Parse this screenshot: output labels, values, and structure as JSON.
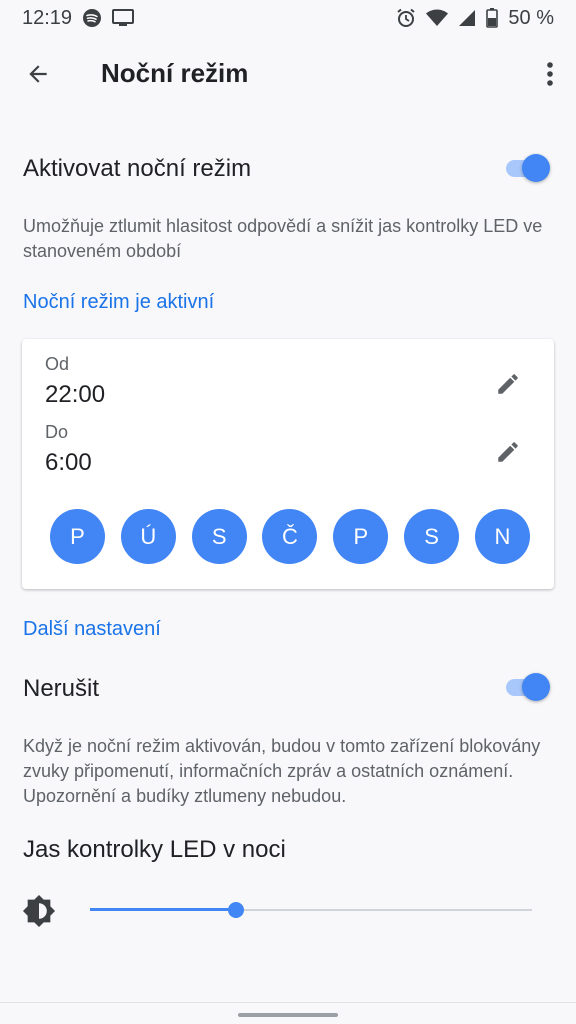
{
  "status_bar": {
    "time": "12:19",
    "battery": "50 %",
    "icons": [
      "spotify-icon",
      "cast-icon",
      "alarm-icon",
      "wifi-icon",
      "signal-icon",
      "battery-icon"
    ]
  },
  "header": {
    "title": "Noční režim",
    "back_icon": "arrow-back-icon",
    "menu_icon": "more-vert-icon"
  },
  "night_mode": {
    "toggle_label": "Aktivovat noční režim",
    "toggle_on": true,
    "description": "Umožňuje ztlumit hlasitost odpovědí a snížit jas kontrolky LED ve stanoveném období",
    "status": "Noční režim je aktivní"
  },
  "schedule": {
    "from_label": "Od",
    "from_value": "22:00",
    "to_label": "Do",
    "to_value": "6:00",
    "days": [
      "P",
      "Ú",
      "S",
      "Č",
      "P",
      "S",
      "N"
    ]
  },
  "more_settings": {
    "heading": "Další nastavení",
    "dnd_label": "Nerušit",
    "dnd_on": true,
    "dnd_description": "Když je noční režim aktivován, budou v tomto zařízení blokovány zvuky připomenutí, informačních zpráv a ostatních oznámení. Upozornění a budíky ztlumeny nebudou.",
    "led_label": "Jas kontrolky LED v noci",
    "led_level": 0.33
  },
  "colors": {
    "accent": "#4285f4",
    "link": "#1a73e8",
    "track": "#a8c7fa"
  }
}
